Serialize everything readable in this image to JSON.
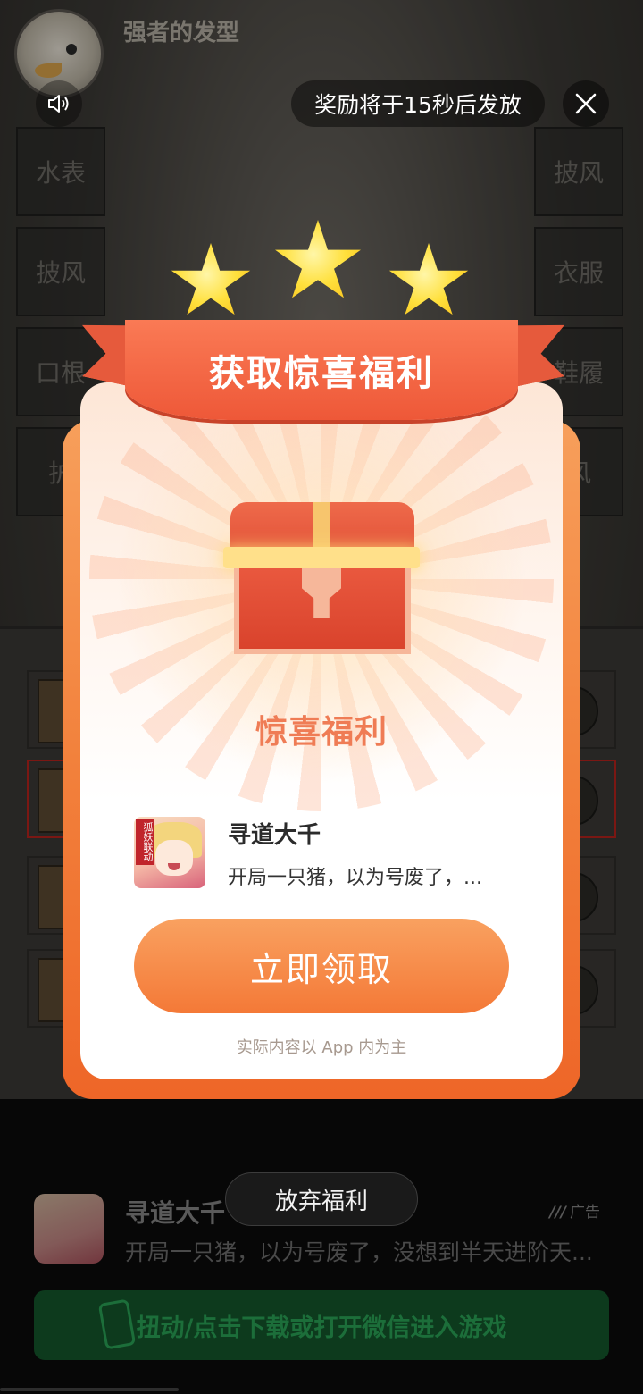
{
  "game": {
    "title": "强者的发型",
    "side_slots_left": [
      "水表",
      "披风",
      "口根",
      "护"
    ],
    "side_slots_right": [
      "披风",
      "衣服",
      "鞋履",
      "风"
    ]
  },
  "overlay": {
    "timer_text": "奖励将于15秒后发放",
    "icons": {
      "sound": "speaker-icon",
      "close": "close-icon"
    }
  },
  "modal": {
    "banner_title": "获取惊喜福利",
    "surprise_title": "惊喜福利",
    "app": {
      "name": "寻道大千",
      "description": "开局一只猪，以为号废了，...",
      "icon_tag": "狐妖联动"
    },
    "claim_button": "立即领取",
    "disclaimer": "实际内容以 App 内为主"
  },
  "ad": {
    "app_name": "寻道大千",
    "label": "广告",
    "description": "开局一只猪，以为号废了，没想到半天进阶天...",
    "download_text": "扭动/点击下载或打开微信进入游戏",
    "abandon_button": "放弃福利"
  },
  "colors": {
    "accent_orange": "#f47937",
    "ribbon_red": "#ee5838",
    "star_yellow": "#ffe03c",
    "download_green": "#0d3a1d"
  }
}
